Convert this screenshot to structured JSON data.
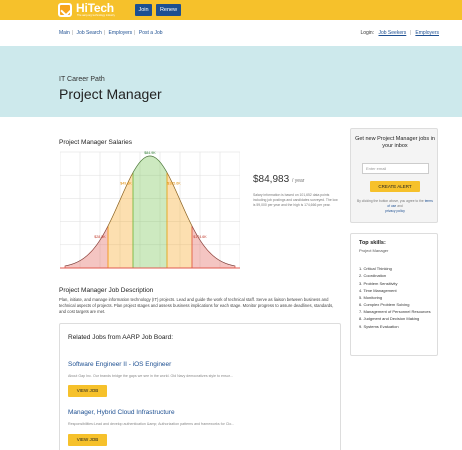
{
  "header": {
    "brand": "HiTech",
    "tagline": "The aarp.org technology industry",
    "join_label": "Join",
    "renew_label": "Renew"
  },
  "nav": {
    "links": [
      "Main",
      "Job Search",
      "Employers",
      "Post a Job"
    ],
    "login_label": "Login:",
    "job_seekers": "Job Seekers",
    "employers": "Employers"
  },
  "hero": {
    "subtitle": "IT Career Path",
    "title": "Project Manager"
  },
  "salaries": {
    "title": "Project Manager Salaries",
    "value": "$84,983",
    "per": "/ year",
    "note": "Salary information is based on 101,652 data points including job postings and candidates surveyed. The low is 59,000 per year and the high is 174,666 per year."
  },
  "chart_data": {
    "type": "area",
    "title": "",
    "xlabel": "",
    "ylabel": "",
    "labels": [
      "$28.5K",
      "$49.6K",
      "$84.9K",
      "$105.6K",
      "$174.6K"
    ],
    "bands": [
      {
        "name": "low",
        "color": "#e05a4f"
      },
      {
        "name": "mid-low",
        "color": "#f6a31e"
      },
      {
        "name": "median",
        "color": "#6fbf4b"
      },
      {
        "name": "mid-high",
        "color": "#f6a31e"
      },
      {
        "name": "high",
        "color": "#e05a4f"
      }
    ],
    "grid": true
  },
  "description": {
    "title": "Project Manager Job Description",
    "text": "Plan, initiate, and manage information technology (IT) projects. Lead and guide the work of technical staff. Serve as liaison between business and technical aspects of projects. Plan project stages and assess business implications for each stage. Monitor progress to assure deadlines, standards, and cost targets are met."
  },
  "related": {
    "title": "Related Jobs from AARP Job Board:",
    "jobs": [
      {
        "title": "Software Engineer II - iOS Engineer",
        "snippet": "About Gap Inc. Our brands bridge the gaps we see in the world. Old Navy democratizes style to ensur...",
        "button": "VIEW JOB"
      },
      {
        "title": "Manager, Hybrid Cloud Infrastructure",
        "snippet": "Responsibilities:Lead and develop authentication &amp; Authorization patterns and frameworks for Clo...",
        "button": "VIEW JOB"
      }
    ]
  },
  "newjobs": {
    "title": "Get new Project Manager jobs in your inbox",
    "placeholder": "Enter email",
    "button": "CREATE ALERT",
    "note_pre": "By clicking the button above, you agree to the",
    "terms": "terms of use",
    "and": "and",
    "privacy": "privacy policy"
  },
  "skills": {
    "title": "Top skills:",
    "subtitle": "Project Manager",
    "items": [
      "1. Critical Thinking",
      "2. Coordination",
      "3. Problem Sensitivity",
      "4. Time Management",
      "5. Monitoring",
      "6. Complex Problem Solving",
      "7. Management of Personnel Resources",
      "8. Judgment and Decision Making",
      "9. Systems Evaluation"
    ]
  }
}
